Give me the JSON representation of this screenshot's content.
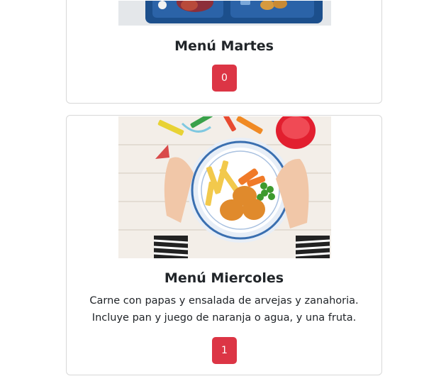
{
  "cards": [
    {
      "title": "Menú Martes",
      "count": "0",
      "image": "kids-food-tray-photo"
    },
    {
      "title": "Menú Miercoles",
      "description": "Carne con papas y ensalada de arvejas y zanahoria. Incluye pan y juego de naranja o agua, y una fruta.",
      "count": "1",
      "image": "kids-plate-nuggets-fries-photo"
    }
  ],
  "colors": {
    "accent": "#dc3545",
    "border": "#d8d8d8"
  }
}
